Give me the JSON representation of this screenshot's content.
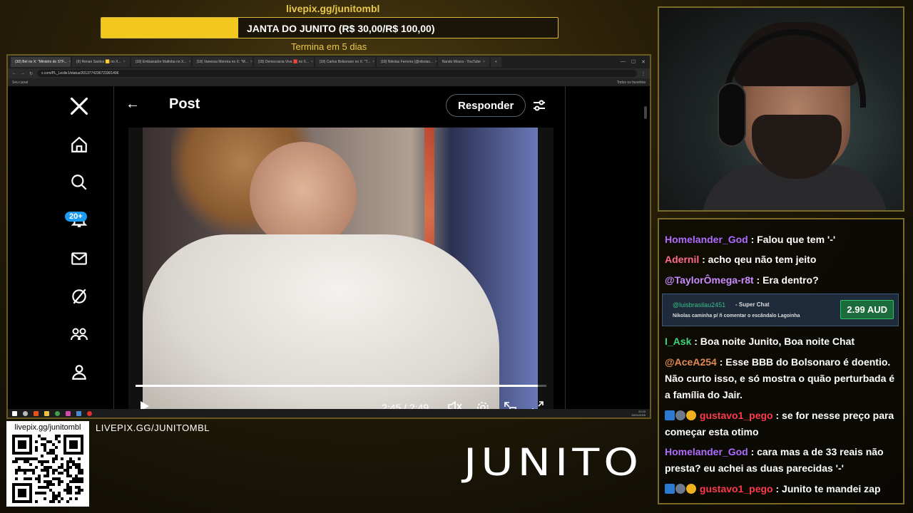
{
  "goal": {
    "url": "livepix.gg/junitombl",
    "title": "JANTA DO JUNITO (R$ 30,00/R$ 100,00)",
    "progress": 0.3,
    "ends": "Termina em 5 dias"
  },
  "browser": {
    "tabs": [
      {
        "label": "(30) Bel no X: \"Ministro do STF...",
        "active": true
      },
      {
        "label": "(9) Renan Santos 🟨 no X..."
      },
      {
        "label": "(18) Embaixador Mafioba no X..."
      },
      {
        "label": "(18) Vanessa Moreira no X: \"M..."
      },
      {
        "label": "(18) Democracia Viva 🟥 no X..."
      },
      {
        "label": "(18) Carlos Bolsonaro no X: \"T..."
      },
      {
        "label": "(18) Nikolas Ferreira (@nikolas..."
      },
      {
        "label": "Nando Moura - YouTube"
      }
    ],
    "url": "x.com/PL_Leslie1/status/2013774236723301406",
    "bookmark": "Seu canal",
    "bookmarks_right": "Todos os favoritos",
    "clock_time": "22:03",
    "clock_date": "19/01/2026"
  },
  "x": {
    "notifications_badge": "20+",
    "post_title": "Post",
    "reply_label": "Responder",
    "video_time": "2:45 / 2:49",
    "video_progress": 0.98
  },
  "stream": {
    "qr_label": "livepix.gg/junitombl",
    "bottom_link": "LIVEPIX.GG/JUNITOMBL",
    "logo": "JUNITO"
  },
  "chat": {
    "messages": [
      {
        "user": "Homelander_God",
        "color": "#b06bff",
        "text": ": Falou que tem '-'"
      },
      {
        "user": "Adernil",
        "color": "#ff6a8a",
        "text": ": acho qeu não tem jeito"
      },
      {
        "user": "@TaylorÔmega-r8t",
        "color": "#c98bff",
        "text": ": Era dentro?"
      },
      {
        "user": "I_Ask",
        "color": "#3fd47a",
        "text": ": Boa noite Junito, Boa noite Chat"
      },
      {
        "user": "@AceA254",
        "color": "#e08a50",
        "text": ": Esse BBB do Bolsonaro é doentio. Não curto isso, e só mostra o quão perturbada é a família do Jair."
      },
      {
        "user": "gustavo1_pego",
        "color": "#ff3a4a",
        "text": ": se for nesse preço para começar esta otimo"
      },
      {
        "user": "Homelander_God",
        "color": "#b06bff",
        "text": ": cara mas a de 33 reais não presta? eu achei as duas parecidas '-'"
      },
      {
        "user": "gustavo1_pego",
        "color": "#ff3a4a",
        "text": ": Junito te mandei zap"
      }
    ],
    "superchat": {
      "user": "@luisbrasilau2451",
      "type": "- Super Chat",
      "message": "Nikolas caminha p/ ñ comentar o escândalo Lagoinha",
      "amount": "2.99 AUD"
    }
  }
}
